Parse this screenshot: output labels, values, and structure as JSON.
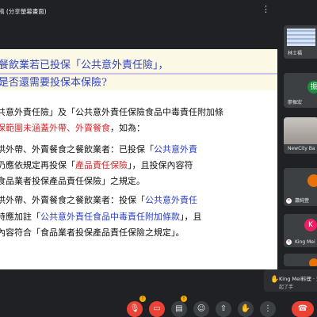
{
  "topbar": {
    "title": "稿 (分享螢幕畫面)",
    "more_icon": "more-vertical-icon"
  },
  "slide": {
    "question_line1": "餐飲業若已投保「公共意外責任險」，",
    "question_line2": "是否還需要投保本保險?",
    "p1_a": "共意外責任險」及「公共意外責任保險食品中毒責任附加條",
    "p1_b_red": "保範圍未涵蓋外帶、外賣餐食",
    "p1_b_rest": "，如為：",
    "p2_a1": "供外帶、外賣餐食之餐飲業者：已投保「",
    "p2_a_blue": "公共意外責",
    "p2_b1": "仍應依規定再投保「",
    "p2_b_red": "產品責任保險",
    "p2_b2": "」，且投保內容符",
    "p3": "食品業者投保產品責任保險」之規定。",
    "p4_a1": "供外帶、外賣餐食之餐飲業者：投保「",
    "p4_a_blue": "公共意外責任",
    "p4_b1": "時應加註「",
    "p4_b_blue": "公共意外責任食品中毒責任附加條款",
    "p4_b2": "」，且",
    "p5": "內容符合「食品業者投保產品責任保險之規定」。"
  },
  "participants": [
    {
      "name": "林士福",
      "kind": "screen"
    },
    {
      "name": "廖振宏",
      "kind": "avatar",
      "initial": "振",
      "color": "#1e8e3e"
    },
    {
      "name": "NewCity Ba",
      "kind": "video"
    },
    {
      "name": "蕭純萱",
      "kind": "avatar",
      "initial": "",
      "color": "#e8710a"
    },
    {
      "name": "King Mei",
      "kind": "avatar",
      "initial": "K",
      "color": "#e91e63"
    },
    {
      "name": "",
      "kind": "avatar",
      "initial": "",
      "color": "#e8710a"
    }
  ],
  "notification": {
    "name": "King Mei料理 · 江",
    "action": "起了手",
    "icon": "raised-hand-icon"
  },
  "controls": {
    "badges": [
      "!",
      "!"
    ],
    "end_icon": "end-call-icon"
  }
}
